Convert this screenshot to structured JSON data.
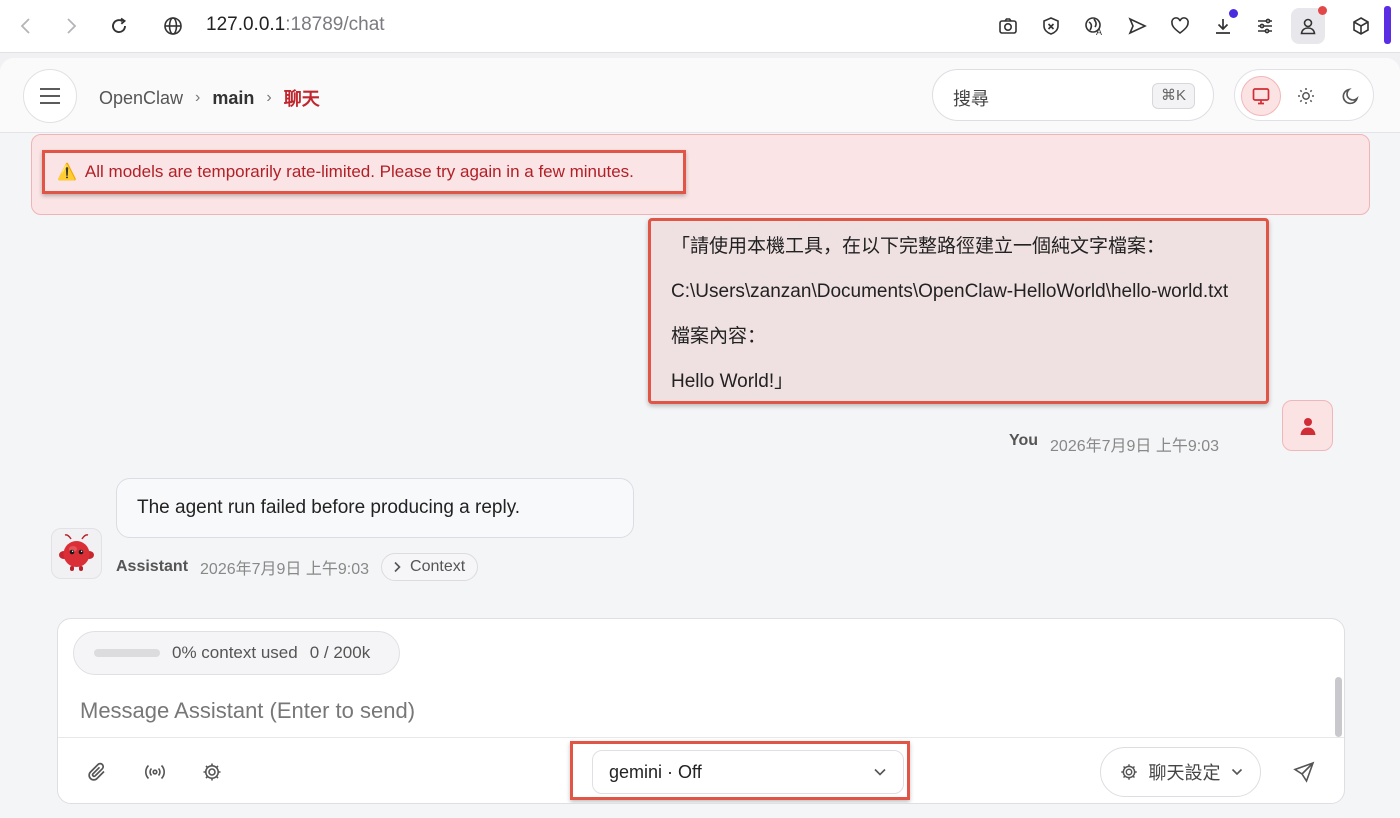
{
  "browser": {
    "url_host": "127.0.0.1",
    "url_rest": ":18789/chat",
    "icons": [
      "back-icon",
      "forward-icon",
      "reload-icon",
      "site-info-icon",
      "camera-icon",
      "shield-icon",
      "translate-icon",
      "send-icon",
      "heart-icon",
      "download-icon",
      "sliders-icon",
      "profile-icon",
      "extension-icon"
    ]
  },
  "header": {
    "breadcrumb": [
      "OpenClaw",
      "main",
      "聊天"
    ],
    "search_label": "搜尋",
    "search_shortcut": "⌘K",
    "theme_active": "system"
  },
  "alert": {
    "icon": "⚠️",
    "text": "All models are temporarily rate-limited. Please try again in a few minutes."
  },
  "messages": {
    "user": {
      "lines": [
        "「請使用本機工具，在以下完整路徑建立一個純文字檔案：",
        "C:\\Users\\zanzan\\Documents\\OpenClaw-HelloWorld\\hello-world.txt",
        "檔案內容：",
        "Hello World!」"
      ],
      "name": "You",
      "time": "2026年7月9日 上午9:03"
    },
    "assistant": {
      "text": "The agent run failed before producing a reply.",
      "name": "Assistant",
      "time": "2026年7月9日 上午9:03",
      "context_label": "Context"
    }
  },
  "composer": {
    "context_text": "0% context used",
    "context_count": "0 / 200k",
    "context_fraction": 0.0,
    "placeholder": "Message Assistant (Enter to send)",
    "model_label": "gemini · Off",
    "settings_label": "聊天設定"
  },
  "colors": {
    "accent": "#d12d36",
    "alert_bg": "#fbe4e5",
    "highlight": "#e05546"
  }
}
